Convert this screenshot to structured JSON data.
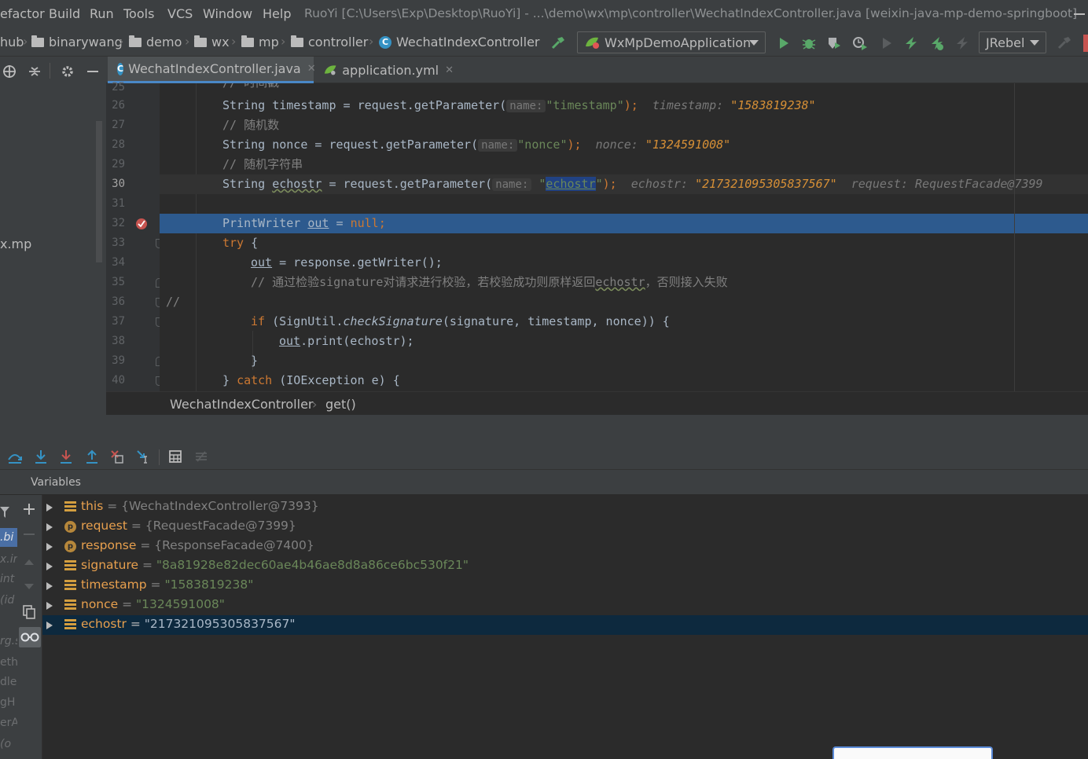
{
  "menu": {
    "items": [
      "efactor",
      "Build",
      "Run",
      "Tools",
      "VCS",
      "Window",
      "Help"
    ],
    "window_title": "RuoYi [C:\\Users\\Exp\\Desktop\\RuoYi] - ...\\demo\\wx\\mp\\controller\\WechatIndexController.java [weixin-java-mp-demo-springboot]"
  },
  "navbar": {
    "crumbs": [
      "hub",
      "binarywang",
      "demo",
      "wx",
      "mp",
      "controller",
      "WechatIndexController"
    ],
    "run_config": "WxMpDemoApplication",
    "jrebel": "JRebel"
  },
  "project": {
    "partial_item": "x.mp"
  },
  "tabs": [
    {
      "label": "WechatIndexController.java",
      "active": true
    },
    {
      "label": "application.yml",
      "active": false
    }
  ],
  "editor": {
    "line_numbers": [
      "25",
      "26",
      "27",
      "28",
      "29",
      "30",
      "31",
      "32",
      "33",
      "34",
      "35",
      "36",
      "37",
      "38",
      "39",
      "40"
    ],
    "line25": "// 时间戳",
    "line26": {
      "code_a": "String timestamp = request.getParameter(",
      "hint": "name:",
      "str": "\"timestamp\"",
      "tail": ");",
      "dbg_label": "timestamp:",
      "dbg_value": "\"1583819238\""
    },
    "line27": "// 随机数",
    "line28": {
      "code_a": "String nonce = request.getParameter(",
      "hint": "name:",
      "str": "\"nonce\"",
      "tail": ");",
      "dbg_label": "nonce:",
      "dbg_value": "\"1324591008\""
    },
    "line29": "// 随机字符串",
    "line30": {
      "code_a": "String ",
      "var": "echostr",
      "code_b": " = request.getParameter(",
      "hint": "name:",
      "q1": "\"",
      "sel": "echostr",
      "q2": "\"",
      "tail": ");",
      "dbg_label": "echostr:",
      "dbg_value": "\"217321095305837567\"",
      "dbg_label2": "request:",
      "dbg_value2": "RequestFacade@7399"
    },
    "line32": {
      "type": "PrintWriter ",
      "var": "out",
      "eq": " = ",
      "nul": "null",
      "semi": ";"
    },
    "line33": {
      "kw": "try",
      "rest": " {"
    },
    "line34": {
      "var": "out",
      "rest": " = response.getWriter();"
    },
    "line35": {
      "a": "// 通过检验signature对请求进行校验，若校验成功则原样返回",
      "b": "echostr",
      "c": "，否则接入失败"
    },
    "line36": "//",
    "line37": {
      "kw": "if",
      "a": " (SignUtil.",
      "m": "checkSignature",
      "b": "(signature, timestamp, nonce)) {"
    },
    "line38": {
      "var": "out",
      "rest": ".print(echostr);"
    },
    "line39": "}",
    "line40": {
      "a": "} ",
      "kw": "catch",
      "b": " (IOException e) {"
    }
  },
  "breadcrumb": {
    "class": "WechatIndexController",
    "method": "get()"
  },
  "debug": {
    "variables_title": "Variables",
    "vars": [
      {
        "name": "this",
        "eq": " = ",
        "value": "{WechatIndexController@7393}",
        "kind": "field"
      },
      {
        "name": "request",
        "eq": " = ",
        "value": "{RequestFacade@7399}",
        "kind": "param"
      },
      {
        "name": "response",
        "eq": " = ",
        "value": "{ResponseFacade@7400}",
        "kind": "param"
      },
      {
        "name": "signature",
        "eq": " = ",
        "value": "\"8a81928e82dec60ae4b46ae8d8a86ce6bc530f21\"",
        "kind": "field"
      },
      {
        "name": "timestamp",
        "eq": " = ",
        "value": "\"1583819238\"",
        "kind": "field"
      },
      {
        "name": "nonce",
        "eq": " = ",
        "value": "\"1324591008\"",
        "kind": "field"
      },
      {
        "name": "echostr",
        "eq": " = ",
        "value": "\"217321095305837567\"",
        "kind": "field",
        "selected": true
      }
    ],
    "frames_partial": [
      ".bi",
      "x.in",
      "int",
      "(id",
      "rg.s",
      "eth",
      "dle",
      "gH",
      "erA",
      "(o"
    ]
  },
  "colors": {
    "accent": "#4a88c7",
    "selection_line": "#2d5a8e",
    "string": "#6a8759",
    "keyword": "#cc7832",
    "debug_value": "#d68f36"
  },
  "icons": [
    "hammer-icon",
    "run-icon",
    "debug-icon",
    "coverage-icon",
    "profile-icon",
    "jrebel-run-icon",
    "jrebel-debug-icon",
    "stop-icon",
    "step-over-icon",
    "step-into-icon",
    "force-step-into-icon",
    "step-out-icon",
    "drop-frame-icon",
    "run-to-cursor-icon",
    "evaluate-icon",
    "trace-icon",
    "breakpoint-icon",
    "lightbulb-icon",
    "add-watch-icon",
    "glasses-icon",
    "copy-icon",
    "gear-icon",
    "locate-icon"
  ]
}
